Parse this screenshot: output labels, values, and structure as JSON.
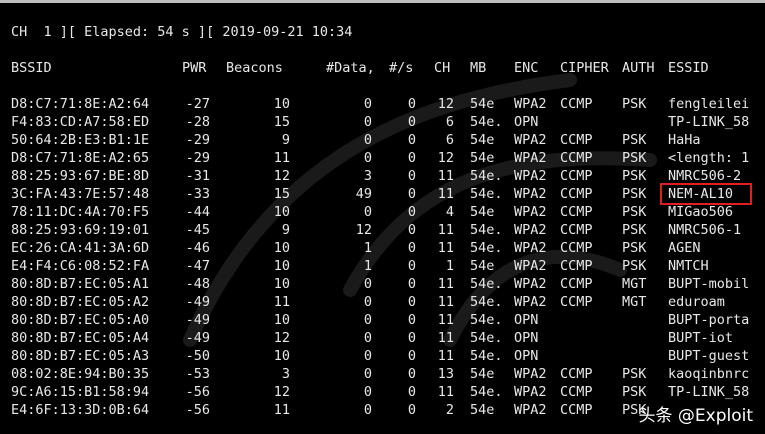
{
  "status_line": "CH  1 ][ Elapsed: 54 s ][ 2019-09-21 10:34",
  "columns": [
    "BSSID",
    "PWR",
    "Beacons",
    "#Data,",
    "#/s",
    "CH",
    "MB",
    "ENC",
    "CIPHER",
    "AUTH",
    "ESSID"
  ],
  "rows": [
    [
      "D8:C7:71:8E:A2:64",
      "-27",
      "10",
      "0",
      "0",
      "12",
      "54e",
      "WPA2",
      "CCMP",
      "PSK",
      "fengleilei"
    ],
    [
      "F4:83:CD:A7:58:ED",
      "-28",
      "15",
      "0",
      "0",
      "6",
      "54e.",
      "OPN",
      "",
      "",
      "TP-LINK_58"
    ],
    [
      "50:64:2B:E3:B1:1E",
      "-29",
      "9",
      "0",
      "0",
      "6",
      "54e",
      "WPA2",
      "CCMP",
      "PSK",
      "HaHa"
    ],
    [
      "D8:C7:71:8E:A2:65",
      "-29",
      "11",
      "0",
      "0",
      "12",
      "54e",
      "WPA2",
      "CCMP",
      "PSK",
      "<length: 1"
    ],
    [
      "88:25:93:67:BE:8D",
      "-31",
      "12",
      "3",
      "0",
      "11",
      "54e.",
      "WPA2",
      "CCMP",
      "PSK",
      "NMRC506-2"
    ],
    [
      "3C:FA:43:7E:57:48",
      "-33",
      "15",
      "49",
      "0",
      "11",
      "54e.",
      "WPA2",
      "CCMP",
      "PSK",
      "NEM-AL10"
    ],
    [
      "78:11:DC:4A:70:F5",
      "-44",
      "10",
      "0",
      "0",
      "4",
      "54e",
      "WPA2",
      "CCMP",
      "PSK",
      "MIGao506"
    ],
    [
      "88:25:93:69:19:01",
      "-45",
      "9",
      "12",
      "0",
      "11",
      "54e.",
      "WPA2",
      "CCMP",
      "PSK",
      "NMRC506-1"
    ],
    [
      "EC:26:CA:41:3A:6D",
      "-46",
      "10",
      "1",
      "0",
      "11",
      "54e.",
      "WPA2",
      "CCMP",
      "PSK",
      "AGEN"
    ],
    [
      "E4:F4:C6:08:52:FA",
      "-47",
      "10",
      "1",
      "0",
      "1",
      "54e",
      "WPA2",
      "CCMP",
      "PSK",
      "NMTCH"
    ],
    [
      "80:8D:B7:EC:05:A1",
      "-48",
      "10",
      "0",
      "0",
      "11",
      "54e.",
      "WPA2",
      "CCMP",
      "MGT",
      "BUPT-mobil"
    ],
    [
      "80:8D:B7:EC:05:A2",
      "-49",
      "11",
      "0",
      "0",
      "11",
      "54e.",
      "WPA2",
      "CCMP",
      "MGT",
      "eduroam"
    ],
    [
      "80:8D:B7:EC:05:A0",
      "-49",
      "10",
      "0",
      "0",
      "11",
      "54e.",
      "OPN",
      "",
      "",
      "BUPT-porta"
    ],
    [
      "80:8D:B7:EC:05:A4",
      "-49",
      "12",
      "0",
      "0",
      "11",
      "54e.",
      "OPN",
      "",
      "",
      "BUPT-iot"
    ],
    [
      "80:8D:B7:EC:05:A3",
      "-50",
      "10",
      "0",
      "0",
      "11",
      "54e.",
      "OPN",
      "",
      "",
      "BUPT-guest"
    ],
    [
      "08:02:8E:94:B0:35",
      "-53",
      "3",
      "0",
      "0",
      "13",
      "54e",
      "WPA2",
      "CCMP",
      "PSK",
      "kaoqinbnrc"
    ],
    [
      "9C:A6:15:B1:58:94",
      "-56",
      "12",
      "0",
      "0",
      "11",
      "54e.",
      "WPA2",
      "CCMP",
      "PSK",
      "TP-LINK_58"
    ],
    [
      "E4:6F:13:3D:0B:64",
      "-56",
      "11",
      "0",
      "0",
      "2",
      "54e",
      "WPA2",
      "CCMP",
      "PSK",
      ""
    ]
  ],
  "highlighted_row": 5,
  "brand": "头条 @Exploit",
  "colors": {
    "background": "#000000",
    "text": "#e8e8e8",
    "highlight": "#e02020"
  }
}
